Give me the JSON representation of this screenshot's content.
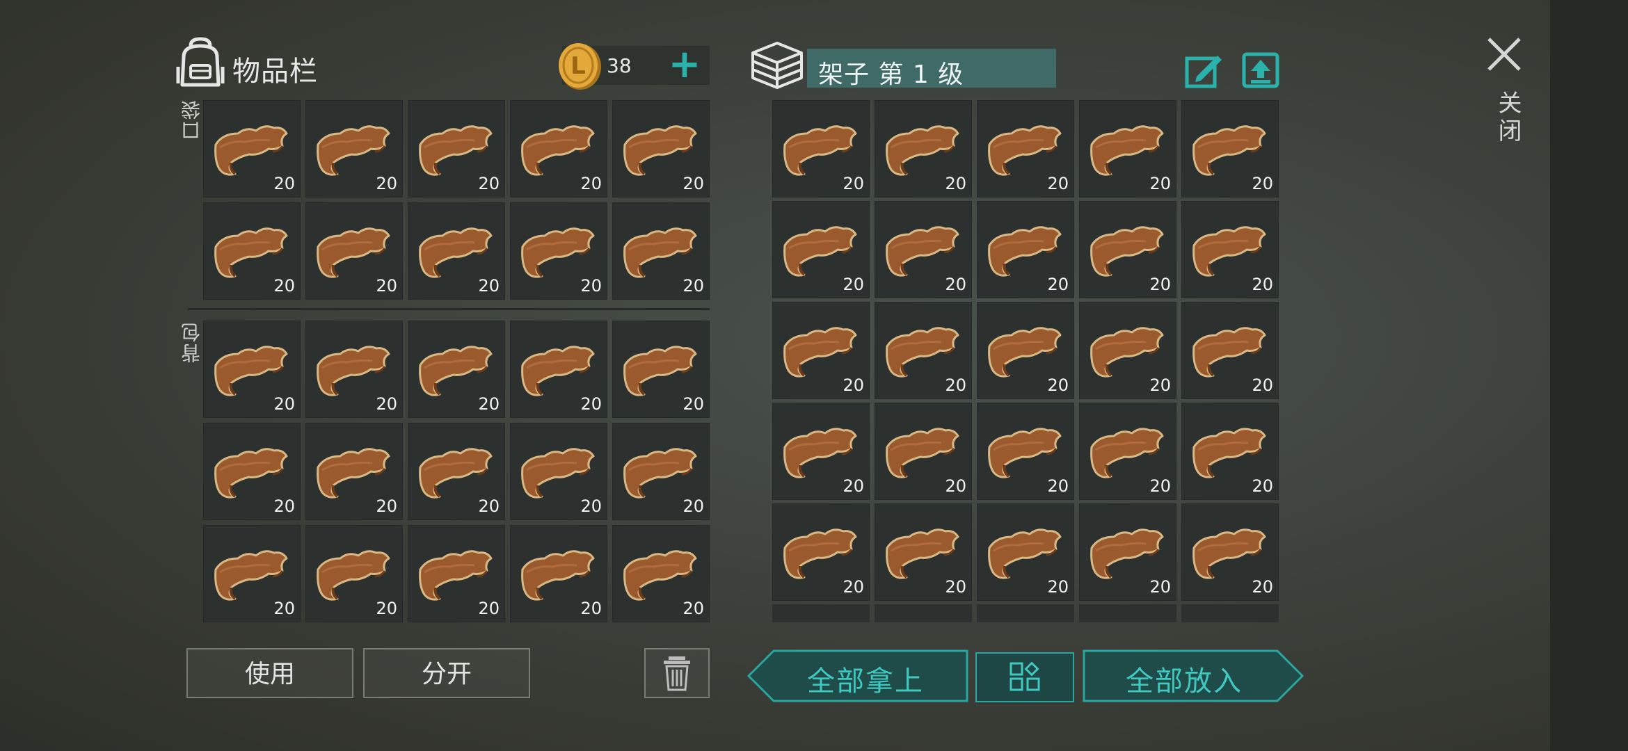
{
  "inventory": {
    "title": "物品栏",
    "coins": "38",
    "add_label": "+",
    "pocket_label": "口袋",
    "backpack_label": "背包",
    "pocket_slots": [
      "20",
      "20",
      "20",
      "20",
      "20",
      "20",
      "20",
      "20",
      "20",
      "20"
    ],
    "backpack_slots": [
      "20",
      "20",
      "20",
      "20",
      "20",
      "20",
      "20",
      "20",
      "20",
      "20",
      "20",
      "20",
      "20",
      "20",
      "20"
    ],
    "item_icon": "leather-icon"
  },
  "shelf": {
    "title": "架子 第 1 级",
    "slots": [
      "20",
      "20",
      "20",
      "20",
      "20",
      "20",
      "20",
      "20",
      "20",
      "20",
      "20",
      "20",
      "20",
      "20",
      "20",
      "20",
      "20",
      "20",
      "20",
      "20",
      "20",
      "20",
      "20",
      "20",
      "20"
    ]
  },
  "actions": {
    "use": "使用",
    "split": "分开",
    "take_all": "全部拿上",
    "put_all": "全部放入"
  },
  "close_label": "关闭",
  "colors": {
    "accent": "#2ab3ad",
    "slot_bg": "#2c312f",
    "title_box": "#3f6a67"
  }
}
